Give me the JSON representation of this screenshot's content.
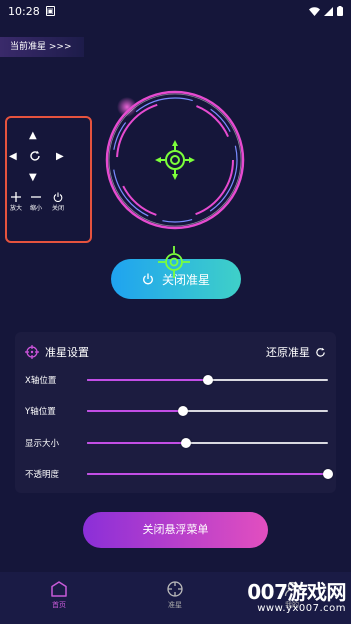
{
  "status_bar": {
    "time": "10:28"
  },
  "banner": {
    "label": "当前准星 >>>"
  },
  "controls": {
    "up_symbol": "▲",
    "down_symbol": "▼",
    "left_symbol": "◀",
    "right_symbol": "▶",
    "zoom_in_label": "放大",
    "zoom_out_label": "缩小",
    "close_label": "关闭"
  },
  "toggle_button": {
    "label": "关闭准星"
  },
  "settings": {
    "title": "准星设置",
    "reset_label": "还原准星",
    "sliders": [
      {
        "label": "X轴位置",
        "value_pct": 50
      },
      {
        "label": "Y轴位置",
        "value_pct": 40
      },
      {
        "label": "显示大小",
        "value_pct": 41
      },
      {
        "label": "不透明度",
        "value_pct": 100
      }
    ]
  },
  "close_menu_button": {
    "label": "关闭悬浮菜单"
  },
  "bottom_nav": {
    "items": [
      {
        "label": "首页",
        "icon": "home-icon",
        "active": true
      },
      {
        "label": "准星",
        "icon": "crosshair-icon",
        "active": false
      },
      {
        "label": "我的",
        "icon": "user-icon",
        "active": false
      }
    ]
  },
  "watermark": {
    "title": "007游戏网",
    "url": "www.yx007.com"
  },
  "colors": {
    "background": "#15163a",
    "accent_pink": "#e24fbf",
    "accent_purple": "#8b2fd8",
    "accent_blue": "#1fa3f0",
    "reticle_green": "#7cff3a",
    "highlight_box": "#e6533e"
  }
}
